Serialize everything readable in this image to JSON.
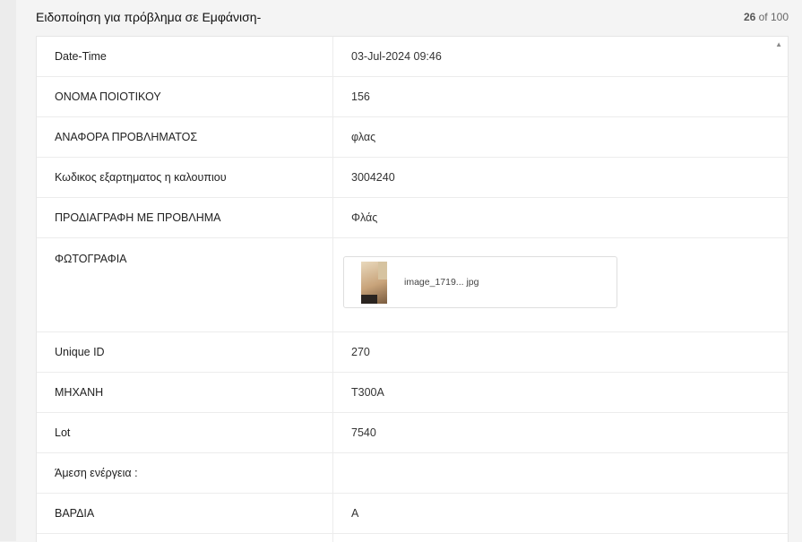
{
  "header": {
    "title": "Ειδοποίηση για πρόβλημα σε Εμφάνιση-",
    "counter_current": "26",
    "counter_rest": " of 100"
  },
  "rows": [
    {
      "label": "Date-Time",
      "value": "03-Jul-2024 09:46"
    },
    {
      "label": "ΟΝΟΜΑ ΠΟΙΟΤΙΚΟΥ",
      "value": "156"
    },
    {
      "label": "ΑΝΑΦΟΡΑ ΠΡΟΒΛΗΜΑΤΟΣ",
      "value": "φλας"
    },
    {
      "label": "Κωδικος εξαρτηματος η καλουπιου",
      "value": "3004240"
    },
    {
      "label": "ΠΡΟΔΙΑΓΡΑΦΗ ΜΕ ΠΡΟΒΛΗΜΑ",
      "value": "Φλάς"
    },
    {
      "label": "ΦΩΤΟΓΡΑΦΙΑ",
      "attachment": "image_1719... jpg"
    },
    {
      "label": "Unique ID",
      "value": "270"
    },
    {
      "label": "ΜΗΧΑΝΗ",
      "value": "T300A"
    },
    {
      "label": "Lot",
      "value": "7540"
    },
    {
      "label": "Άμεση ενέργεια :",
      "value": ""
    },
    {
      "label": "ΒΑΡΔΙΑ",
      "value": "A"
    }
  ],
  "icons": {
    "scroll_up": "chevron-up-icon",
    "thumbnail": "image-thumbnail-icon"
  }
}
